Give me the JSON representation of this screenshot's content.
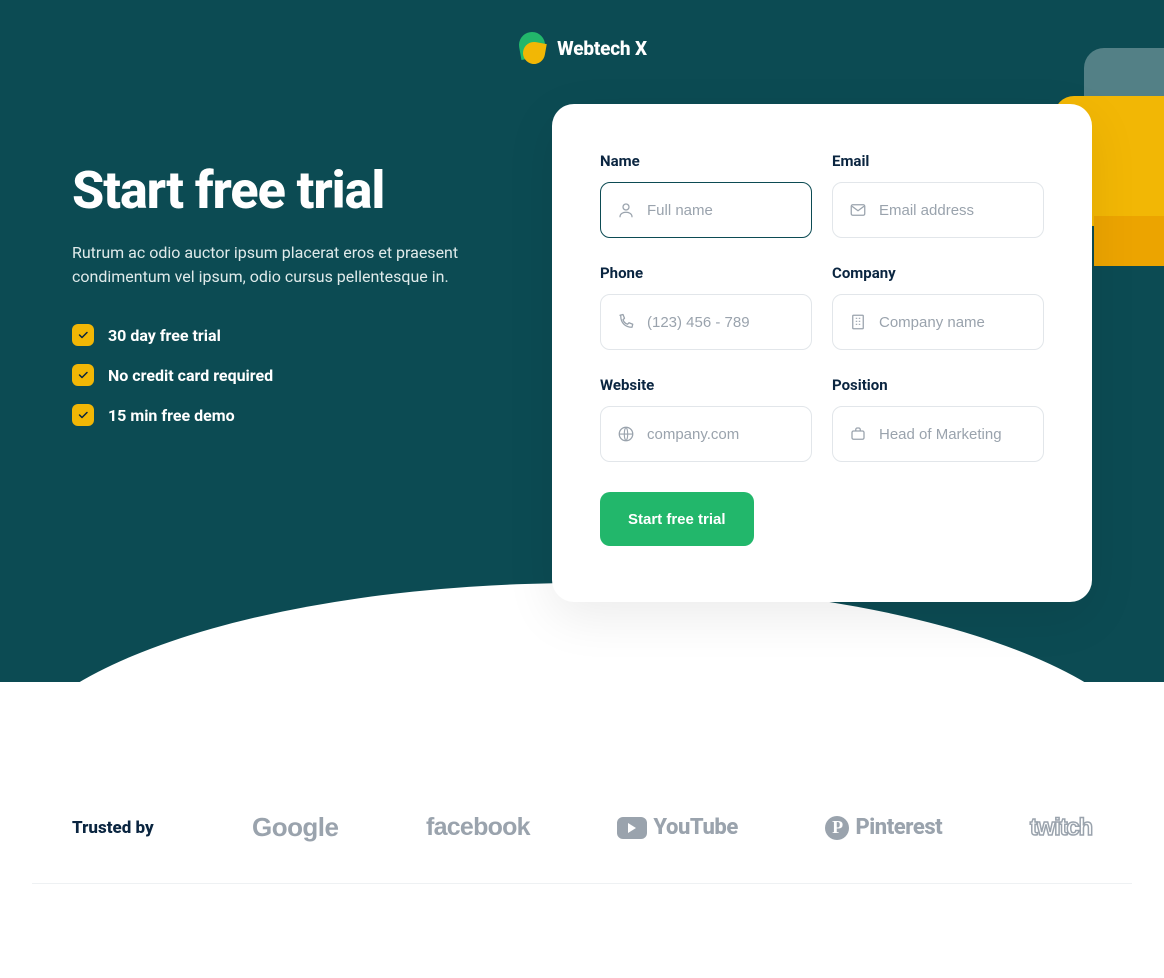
{
  "brand": {
    "name": "Webtech X"
  },
  "hero": {
    "title": "Start free trial",
    "lead": "Rutrum ac odio auctor ipsum placerat eros et praesent condimentum vel ipsum, odio cursus pellentesque in.",
    "bullets": [
      "30 day free trial",
      "No credit card required",
      "15 min free demo"
    ]
  },
  "form": {
    "fields": {
      "name": {
        "label": "Name",
        "placeholder": "Full name"
      },
      "email": {
        "label": "Email",
        "placeholder": "Email address"
      },
      "phone": {
        "label": "Phone",
        "placeholder": "(123) 456 - 789"
      },
      "company": {
        "label": "Company",
        "placeholder": "Company name"
      },
      "website": {
        "label": "Website",
        "placeholder": "company.com"
      },
      "position": {
        "label": "Position",
        "placeholder": "Head of Marketing"
      }
    },
    "submit_label": "Start free trial"
  },
  "trusted": {
    "label": "Trusted by",
    "logos": [
      "Google",
      "facebook",
      "YouTube",
      "Pinterest",
      "twitch"
    ]
  }
}
